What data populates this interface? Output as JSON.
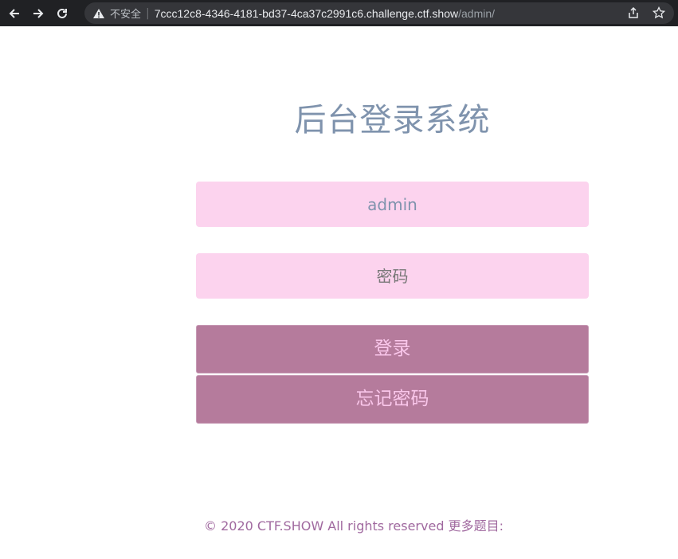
{
  "browser": {
    "security_label": "不安全",
    "url_host": "7ccc12c8-4346-4181-bd37-4ca37c2991c6.challenge.ctf.show",
    "url_path": "/admin/",
    "icons": [
      "back-arrow-icon",
      "forward-arrow-icon",
      "reload-icon",
      "warning-icon",
      "share-icon",
      "star-icon"
    ]
  },
  "login": {
    "title": "后台登录系统",
    "username_value": "admin",
    "password_placeholder": "密码",
    "login_button": "登录",
    "forgot_button": "忘记密码"
  },
  "footer": {
    "text": "© 2020 CTF.SHOW All rights reserved 更多题目:"
  },
  "colors": {
    "title": "#7f93ad",
    "field_bg": "#fcd3ee",
    "button_bg": "#b57b9c",
    "button_text": "#f9c6ea",
    "footer_text": "#a0699f"
  }
}
